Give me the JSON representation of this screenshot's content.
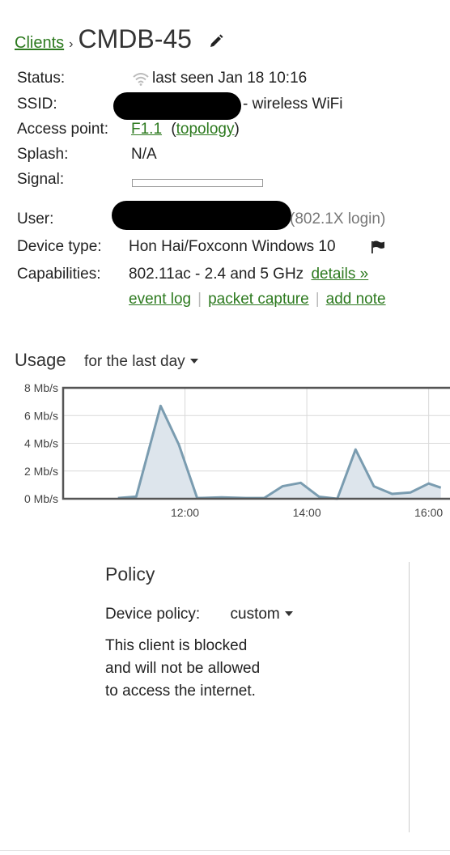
{
  "header": {
    "breadcrumb": "Clients",
    "separator": "›",
    "title": "CMDB-45"
  },
  "props": {
    "status_label": "Status:",
    "status_value": "last seen Jan 18 10:16",
    "ssid_label": "SSID:",
    "ssid_suffix": "- wireless WiFi",
    "ap_label": "Access point:",
    "ap_value": "F1.1",
    "ap_topology": "topology",
    "splash_label": "Splash:",
    "splash_value": "N/A",
    "signal_label": "Signal:",
    "user_label": "User:",
    "user_suffix": "(802.1X login)",
    "device_label": "Device type:",
    "device_value": "Hon Hai/Foxconn Windows 10",
    "cap_label": "Capabilities:",
    "cap_value": "802.11ac - 2.4 and 5 GHz",
    "cap_details": "details »",
    "link_event_log": "event log",
    "link_packet_capture": "packet capture",
    "link_add_note": "add note"
  },
  "usage": {
    "title": "Usage",
    "range": "for the last day"
  },
  "chart_data": {
    "type": "area",
    "x": [
      10.9,
      11.2,
      11.6,
      11.9,
      12.2,
      12.6,
      13.0,
      13.3,
      13.6,
      13.9,
      14.2,
      14.5,
      14.8,
      15.1,
      15.4,
      15.7,
      16.0,
      16.2
    ],
    "values": [
      0.05,
      0.15,
      6.7,
      3.9,
      0.05,
      0.1,
      0.05,
      0.05,
      0.9,
      1.15,
      0.15,
      0.0,
      3.55,
      0.9,
      0.35,
      0.45,
      1.1,
      0.8
    ],
    "xlim": [
      10.0,
      16.35
    ],
    "ylim": [
      0,
      8
    ],
    "x_ticks": [
      12,
      14,
      16
    ],
    "x_tick_labels": [
      "12:00",
      "14:00",
      "16:00"
    ],
    "y_ticks": [
      0,
      2,
      4,
      6,
      8
    ],
    "y_tick_labels": [
      "0 Mb/s",
      "2 Mb/s",
      "4 Mb/s",
      "6 Mb/s",
      "8 Mb/s"
    ],
    "grid": true,
    "line_color": "#7a9cb0",
    "fill_color": "#dde5ec"
  },
  "policy": {
    "title": "Policy",
    "device_policy_label": "Device policy:",
    "device_policy_value": "custom",
    "message_line1": "This client is blocked",
    "message_line2": "and will not be allowed",
    "message_line3": "to access the internet."
  },
  "colors": {
    "link": "#2d7a1f",
    "redaction": "#000000"
  }
}
